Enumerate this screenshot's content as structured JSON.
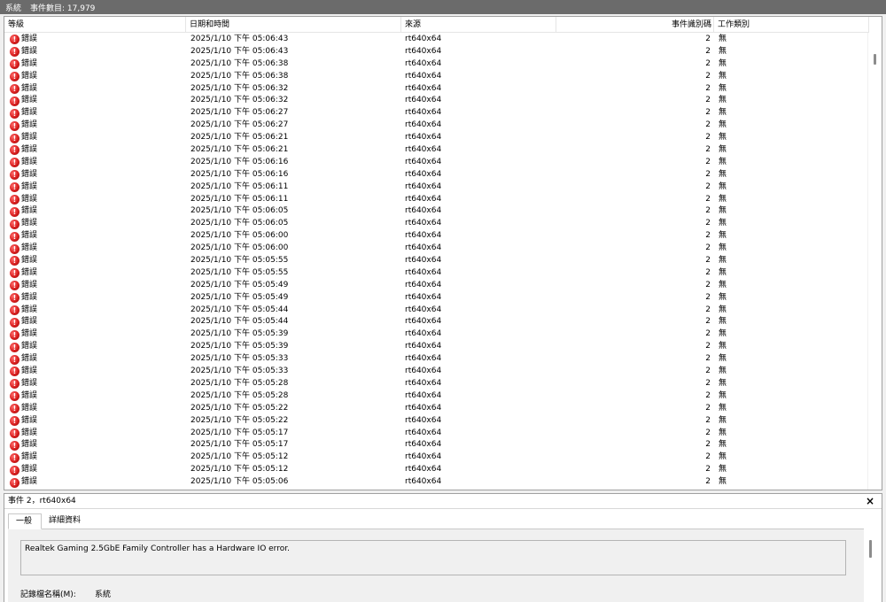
{
  "titlebar": {
    "log_name": "系統",
    "event_count": "事件數目: 17,979"
  },
  "columns": {
    "level": "等級",
    "date": "日期和時間",
    "source": "來源",
    "event_id": "事件識別碼",
    "task": "工作類別"
  },
  "rows": [
    {
      "level": "錯誤",
      "date": "2025/1/10 下午 05:06:43",
      "source": "rt640x64",
      "event_id": "2",
      "task": "無"
    },
    {
      "level": "錯誤",
      "date": "2025/1/10 下午 05:06:43",
      "source": "rt640x64",
      "event_id": "2",
      "task": "無"
    },
    {
      "level": "錯誤",
      "date": "2025/1/10 下午 05:06:38",
      "source": "rt640x64",
      "event_id": "2",
      "task": "無"
    },
    {
      "level": "錯誤",
      "date": "2025/1/10 下午 05:06:38",
      "source": "rt640x64",
      "event_id": "2",
      "task": "無"
    },
    {
      "level": "錯誤",
      "date": "2025/1/10 下午 05:06:32",
      "source": "rt640x64",
      "event_id": "2",
      "task": "無"
    },
    {
      "level": "錯誤",
      "date": "2025/1/10 下午 05:06:32",
      "source": "rt640x64",
      "event_id": "2",
      "task": "無"
    },
    {
      "level": "錯誤",
      "date": "2025/1/10 下午 05:06:27",
      "source": "rt640x64",
      "event_id": "2",
      "task": "無"
    },
    {
      "level": "錯誤",
      "date": "2025/1/10 下午 05:06:27",
      "source": "rt640x64",
      "event_id": "2",
      "task": "無"
    },
    {
      "level": "錯誤",
      "date": "2025/1/10 下午 05:06:21",
      "source": "rt640x64",
      "event_id": "2",
      "task": "無"
    },
    {
      "level": "錯誤",
      "date": "2025/1/10 下午 05:06:21",
      "source": "rt640x64",
      "event_id": "2",
      "task": "無"
    },
    {
      "level": "錯誤",
      "date": "2025/1/10 下午 05:06:16",
      "source": "rt640x64",
      "event_id": "2",
      "task": "無"
    },
    {
      "level": "錯誤",
      "date": "2025/1/10 下午 05:06:16",
      "source": "rt640x64",
      "event_id": "2",
      "task": "無"
    },
    {
      "level": "錯誤",
      "date": "2025/1/10 下午 05:06:11",
      "source": "rt640x64",
      "event_id": "2",
      "task": "無"
    },
    {
      "level": "錯誤",
      "date": "2025/1/10 下午 05:06:11",
      "source": "rt640x64",
      "event_id": "2",
      "task": "無"
    },
    {
      "level": "錯誤",
      "date": "2025/1/10 下午 05:06:05",
      "source": "rt640x64",
      "event_id": "2",
      "task": "無"
    },
    {
      "level": "錯誤",
      "date": "2025/1/10 下午 05:06:05",
      "source": "rt640x64",
      "event_id": "2",
      "task": "無"
    },
    {
      "level": "錯誤",
      "date": "2025/1/10 下午 05:06:00",
      "source": "rt640x64",
      "event_id": "2",
      "task": "無"
    },
    {
      "level": "錯誤",
      "date": "2025/1/10 下午 05:06:00",
      "source": "rt640x64",
      "event_id": "2",
      "task": "無"
    },
    {
      "level": "錯誤",
      "date": "2025/1/10 下午 05:05:55",
      "source": "rt640x64",
      "event_id": "2",
      "task": "無"
    },
    {
      "level": "錯誤",
      "date": "2025/1/10 下午 05:05:55",
      "source": "rt640x64",
      "event_id": "2",
      "task": "無"
    },
    {
      "level": "錯誤",
      "date": "2025/1/10 下午 05:05:49",
      "source": "rt640x64",
      "event_id": "2",
      "task": "無"
    },
    {
      "level": "錯誤",
      "date": "2025/1/10 下午 05:05:49",
      "source": "rt640x64",
      "event_id": "2",
      "task": "無"
    },
    {
      "level": "錯誤",
      "date": "2025/1/10 下午 05:05:44",
      "source": "rt640x64",
      "event_id": "2",
      "task": "無"
    },
    {
      "level": "錯誤",
      "date": "2025/1/10 下午 05:05:44",
      "source": "rt640x64",
      "event_id": "2",
      "task": "無"
    },
    {
      "level": "錯誤",
      "date": "2025/1/10 下午 05:05:39",
      "source": "rt640x64",
      "event_id": "2",
      "task": "無"
    },
    {
      "level": "錯誤",
      "date": "2025/1/10 下午 05:05:39",
      "source": "rt640x64",
      "event_id": "2",
      "task": "無"
    },
    {
      "level": "錯誤",
      "date": "2025/1/10 下午 05:05:33",
      "source": "rt640x64",
      "event_id": "2",
      "task": "無"
    },
    {
      "level": "錯誤",
      "date": "2025/1/10 下午 05:05:33",
      "source": "rt640x64",
      "event_id": "2",
      "task": "無"
    },
    {
      "level": "錯誤",
      "date": "2025/1/10 下午 05:05:28",
      "source": "rt640x64",
      "event_id": "2",
      "task": "無"
    },
    {
      "level": "錯誤",
      "date": "2025/1/10 下午 05:05:28",
      "source": "rt640x64",
      "event_id": "2",
      "task": "無"
    },
    {
      "level": "錯誤",
      "date": "2025/1/10 下午 05:05:22",
      "source": "rt640x64",
      "event_id": "2",
      "task": "無"
    },
    {
      "level": "錯誤",
      "date": "2025/1/10 下午 05:05:22",
      "source": "rt640x64",
      "event_id": "2",
      "task": "無"
    },
    {
      "level": "錯誤",
      "date": "2025/1/10 下午 05:05:17",
      "source": "rt640x64",
      "event_id": "2",
      "task": "無"
    },
    {
      "level": "錯誤",
      "date": "2025/1/10 下午 05:05:17",
      "source": "rt640x64",
      "event_id": "2",
      "task": "無"
    },
    {
      "level": "錯誤",
      "date": "2025/1/10 下午 05:05:12",
      "source": "rt640x64",
      "event_id": "2",
      "task": "無"
    },
    {
      "level": "錯誤",
      "date": "2025/1/10 下午 05:05:12",
      "source": "rt640x64",
      "event_id": "2",
      "task": "無"
    },
    {
      "level": "錯誤",
      "date": "2025/1/10 下午 05:05:06",
      "source": "rt640x64",
      "event_id": "2",
      "task": "無"
    }
  ],
  "detail": {
    "title": "事件 2，rt640x64",
    "close_glyph": "×",
    "tabs": {
      "general": "一般",
      "details": "詳細資料"
    },
    "description": "Realtek Gaming 2.5GbE Family Controller has a Hardware IO error.",
    "log_name_label": "記錄檔名稱(M):",
    "log_name_value": "系統"
  },
  "icons": {
    "row_level": "error-icon",
    "row_level_glyph": "!"
  },
  "colors": {
    "titlebar": "#6b6b6b",
    "error": "#d81e1e"
  }
}
